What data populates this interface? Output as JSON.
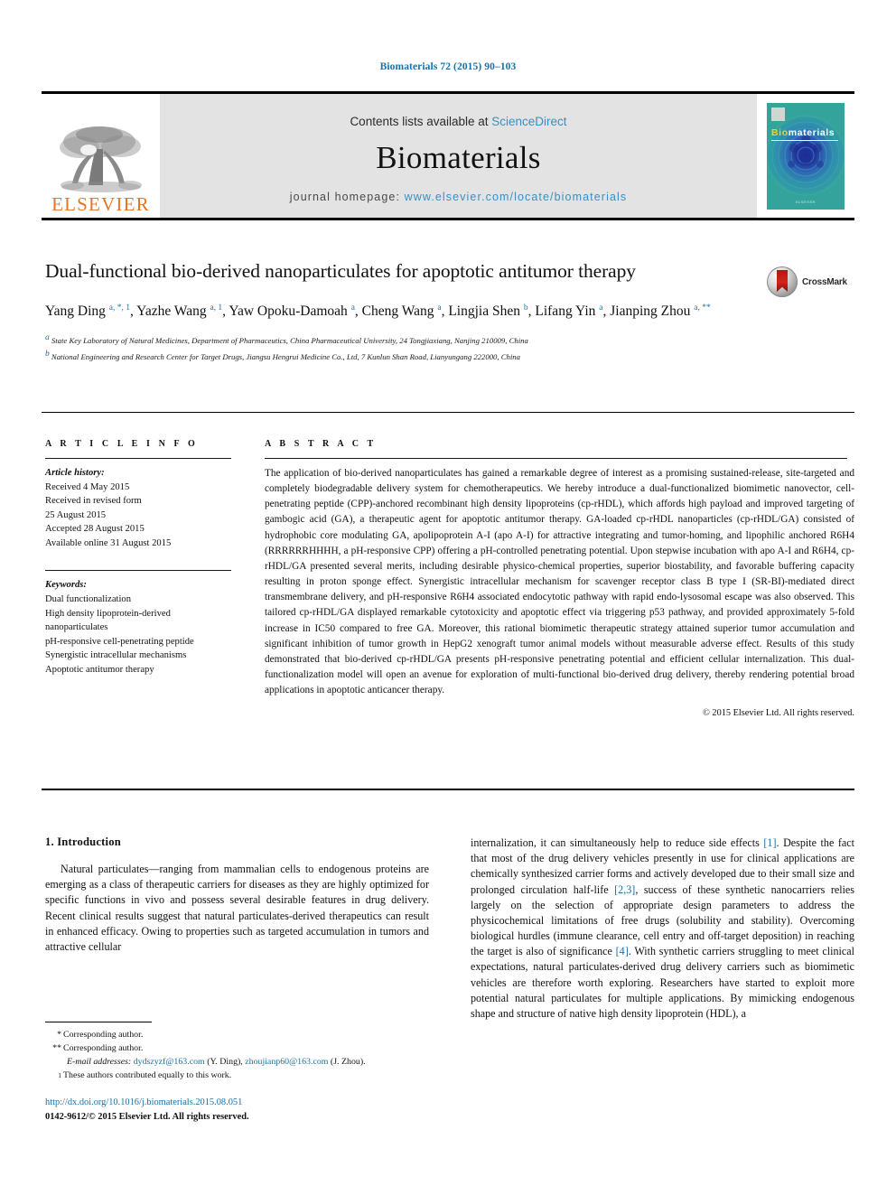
{
  "running_head": "Biomaterials 72 (2015) 90–103",
  "masthead": {
    "publisher_name": "ELSEVIER",
    "publisher_logo_icon": "elsevier-tree-logo",
    "contents_prefix": "Contents lists available at ",
    "contents_link": "ScienceDirect",
    "journal_name": "Biomaterials",
    "homepage_label": "journal homepage: ",
    "homepage_url": "www.elsevier.com/locate/biomaterials",
    "cover": {
      "title_part1": "Bio",
      "title_part2": "materials",
      "footer": "ELSEVIER"
    }
  },
  "article": {
    "title": "Dual-functional bio-derived nanoparticulates for apoptotic antitumor therapy",
    "authors_html": "Yang Ding <sup>a, *, 1</sup>, Yazhe Wang <sup>a, 1</sup>, Yaw Opoku-Damoah <sup>a</sup>, Cheng Wang <sup>a</sup>, Lingjia Shen <sup>b</sup>, Lifang Yin <sup>a</sup>, Jianping Zhou <sup>a, **</sup>",
    "affiliation_a": "State Key Laboratory of Natural Medicines, Department of Pharmaceutics, China Pharmaceutical University, 24 Tongjiaxiang, Nanjing 210009, China",
    "affiliation_b": "National Engineering and Research Center for Target Drugs, Jiangsu Hengrui Medicine Co., Ltd, 7 Kunlun Shan Road, Lianyungang 222000, China",
    "crossmark_label": "CrossMark",
    "crossmark_icon": "crossmark-badge-icon"
  },
  "article_info": {
    "heading": "A R T I C L E  I N F O",
    "history_label": "Article history:",
    "history_lines": [
      "Received 4 May 2015",
      "Received in revised form",
      "25 August 2015",
      "Accepted 28 August 2015",
      "Available online 31 August 2015"
    ],
    "keywords_label": "Keywords:",
    "keywords": [
      "Dual functionalization",
      "High density lipoprotein-derived",
      "nanoparticulates",
      "pH-responsive cell-penetrating peptide",
      "Synergistic intracellular mechanisms",
      "Apoptotic antitumor therapy"
    ]
  },
  "abstract": {
    "heading": "A B S T R A C T",
    "text": "The application of bio-derived nanoparticulates has gained a remarkable degree of interest as a promising sustained-release, site-targeted and completely biodegradable delivery system for chemotherapeutics. We hereby introduce a dual-functionalized biomimetic nanovector, cell-penetrating peptide (CPP)-anchored recombinant high density lipoproteins (cp-rHDL), which affords high payload and improved targeting of gambogic acid (GA), a therapeutic agent for apoptotic antitumor therapy. GA-loaded cp-rHDL nanoparticles (cp-rHDL/GA) consisted of hydrophobic core modulating GA, apolipoprotein A-I (apo A-I) for attractive integrating and tumor-homing, and lipophilic anchored R6H4 (RRRRRRHHHH, a pH-responsive CPP) offering a pH-controlled penetrating potential. Upon stepwise incubation with apo A-I and R6H4, cp-rHDL/GA presented several merits, including desirable physico-chemical properties, superior biostability, and favorable buffering capacity resulting in proton sponge effect. Synergistic intracellular mechanism for scavenger receptor class B type I (SR-BI)-mediated direct transmembrane delivery, and pH-responsive R6H4 associated endocytotic pathway with rapid endo-lysosomal escape was also observed. This tailored cp-rHDL/GA displayed remarkable cytotoxicity and apoptotic effect via triggering p53 pathway, and provided approximately 5-fold increase in IC50 compared to free GA. Moreover, this rational biomimetic therapeutic strategy attained superior tumor accumulation and significant inhibition of tumor growth in HepG2 xenograft tumor animal models without measurable adverse effect. Results of this study demonstrated that bio-derived cp-rHDL/GA presents pH-responsive penetrating potential and efficient cellular internalization. This dual-functionalization model will open an avenue for exploration of multi-functional bio-derived drug delivery, thereby rendering potential broad applications in apoptotic anticancer therapy.",
    "copyright": "© 2015 Elsevier Ltd. All rights reserved."
  },
  "introduction": {
    "heading": "1. Introduction",
    "left_paragraph": "Natural particulates—ranging from mammalian cells to endogenous proteins are emerging as a class of therapeutic carriers for diseases as they are highly optimized for specific functions in vivo and possess several desirable features in drug delivery. Recent clinical results suggest that natural particulates-derived therapeutics can result in enhanced efficacy. Owing to properties such as targeted accumulation in tumors and attractive cellular",
    "right_paragraph_html": "internalization, it can simultaneously help to reduce side effects <span class=\"ref\">[1]</span>. Despite the fact that most of the drug delivery vehicles presently in use for clinical applications are chemically synthesized carrier forms and actively developed due to their small size and prolonged circulation half-life <span class=\"ref\">[2,3]</span>, success of these synthetic nanocarriers relies largely on the selection of appropriate design parameters to address the physicochemical limitations of free drugs (solubility and stability). Overcoming biological hurdles (immune clearance, cell entry and off-target deposition) in reaching the target is also of significance <span class=\"ref\">[4]</span>. With synthetic carriers struggling to meet clinical expectations, natural particulates-derived drug delivery carriers such as biomimetic vehicles are therefore worth exploring. Researchers have started to exploit more potential natural particulates for multiple applications. By mimicking endogenous shape and structure of native high density lipoprotein (HDL), a"
  },
  "footnotes": {
    "corresponding_1_mark": "*",
    "corresponding_1": "Corresponding author.",
    "corresponding_2_mark": "**",
    "corresponding_2": "Corresponding author.",
    "email_label": "E-mail addresses:",
    "email_1": "dydszyzf@163.com",
    "email_1_owner": "(Y. Ding),",
    "email_2": "zhoujianp60@163.com",
    "email_2_owner": "(J. Zhou).",
    "equal_mark": "1",
    "equal_contrib": "These authors contributed equally to this work."
  },
  "footer": {
    "doi_url": "http://dx.doi.org/10.1016/j.biomaterials.2015.08.051",
    "issn_line": "0142-9612/© 2015 Elsevier Ltd. All rights reserved."
  },
  "colors": {
    "link": "#1b70a6",
    "elsevier_orange": "#e87422",
    "masthead_grey": "#e3e3e3",
    "cover_teal": "#2e9c9c"
  }
}
